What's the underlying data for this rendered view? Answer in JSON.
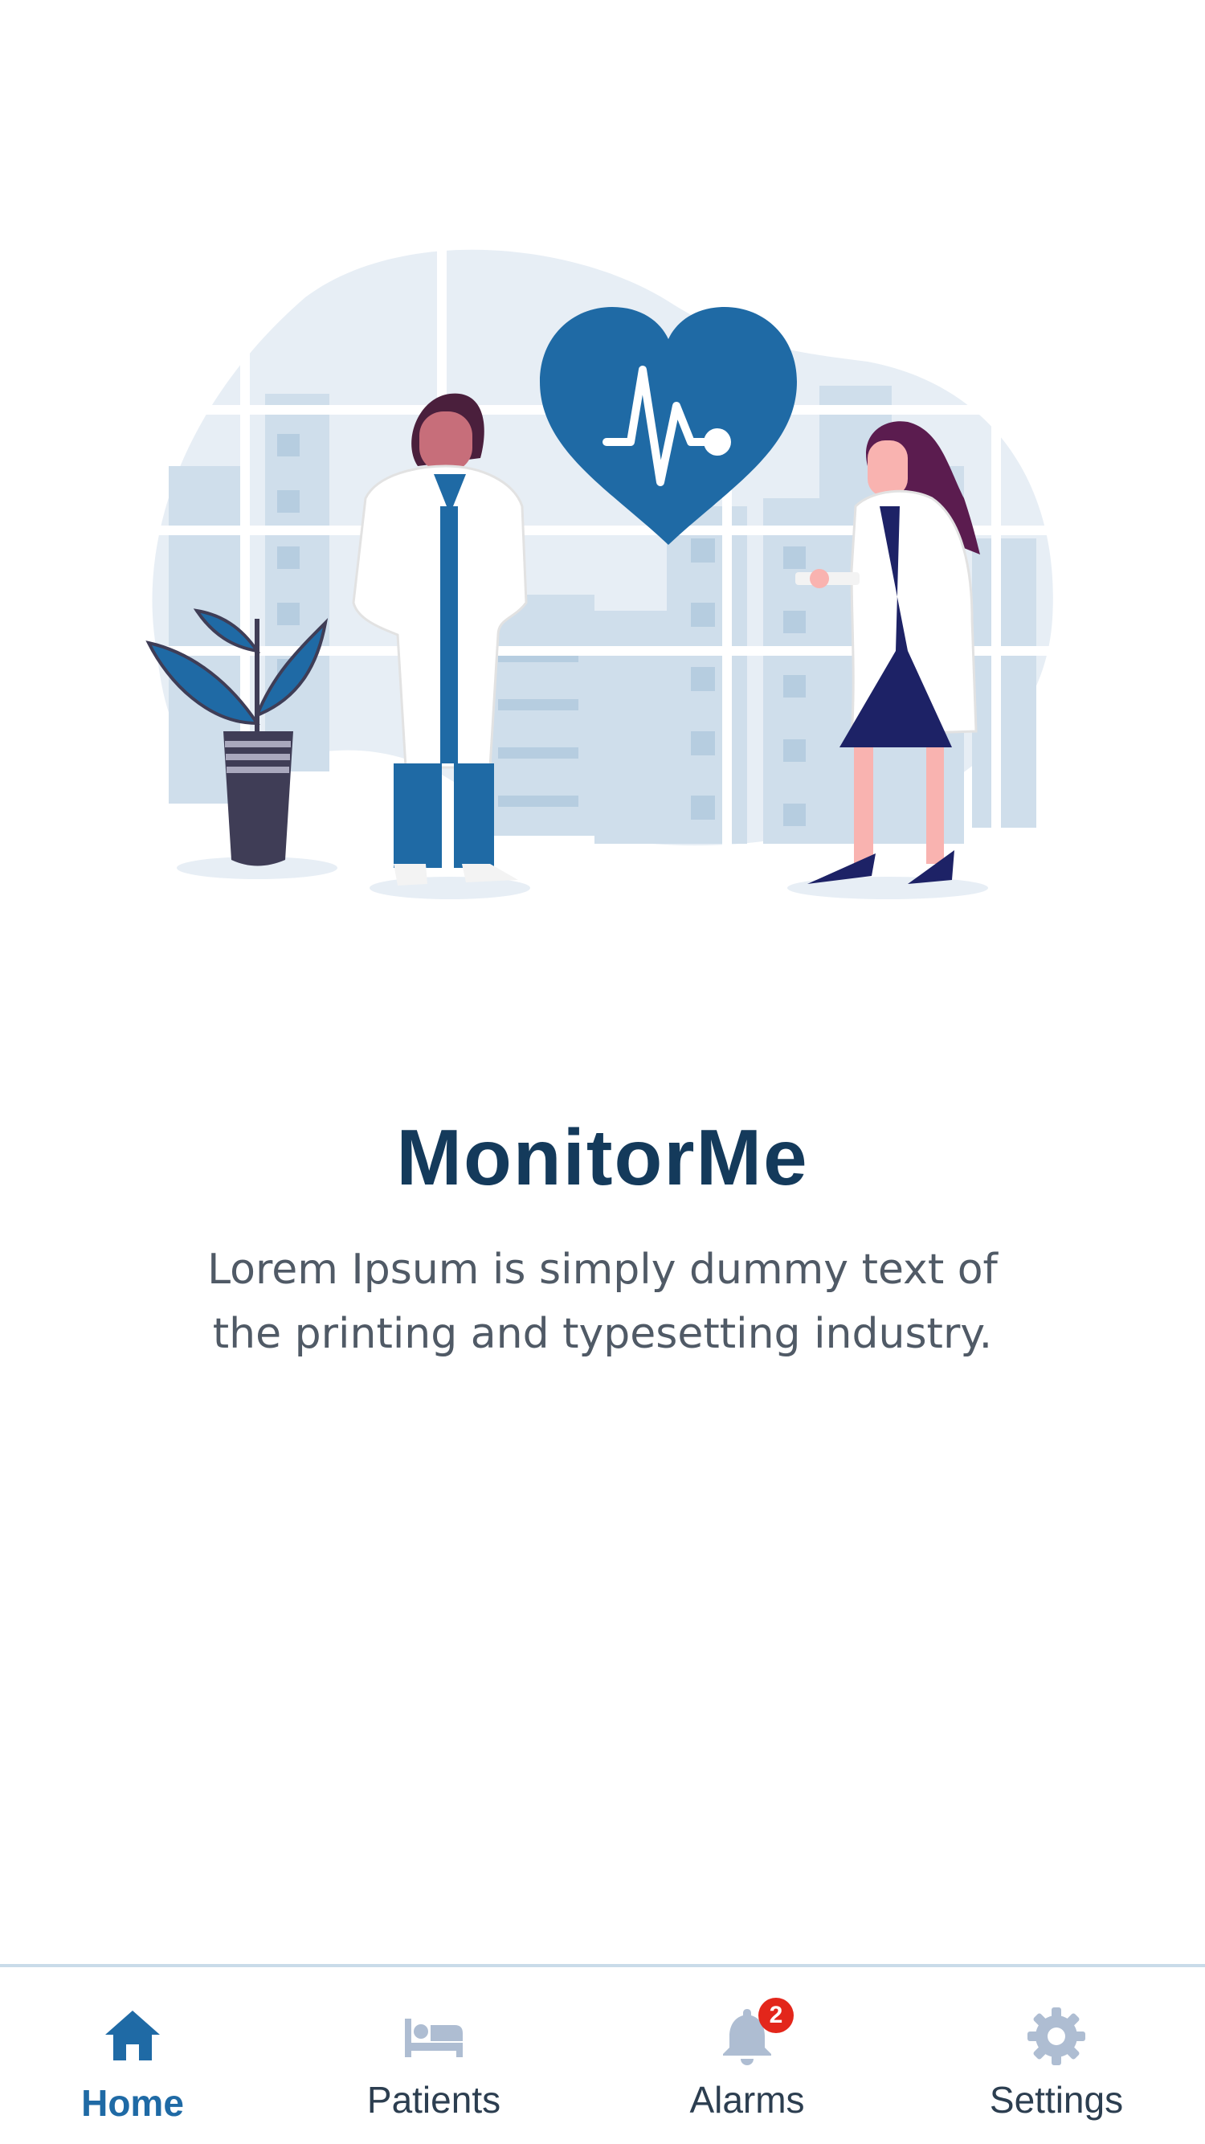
{
  "app": {
    "title": "MonitorMe",
    "subtitle": "Lorem Ipsum is simply dummy text of the printing and typesetting industry."
  },
  "colors": {
    "brand_dark": "#143a5b",
    "brand_blue": "#1f6aa5",
    "inactive_icon": "#aebdd2",
    "badge_red": "#e3261b",
    "text_muted": "#505a66"
  },
  "tabbar": {
    "items": [
      {
        "label": "Home",
        "icon": "home-icon",
        "active": true
      },
      {
        "label": "Patients",
        "icon": "bed-icon",
        "active": false
      },
      {
        "label": "Alarms",
        "icon": "bell-icon",
        "active": false,
        "badge": "2"
      },
      {
        "label": "Settings",
        "icon": "gear-icon",
        "active": false
      }
    ]
  }
}
